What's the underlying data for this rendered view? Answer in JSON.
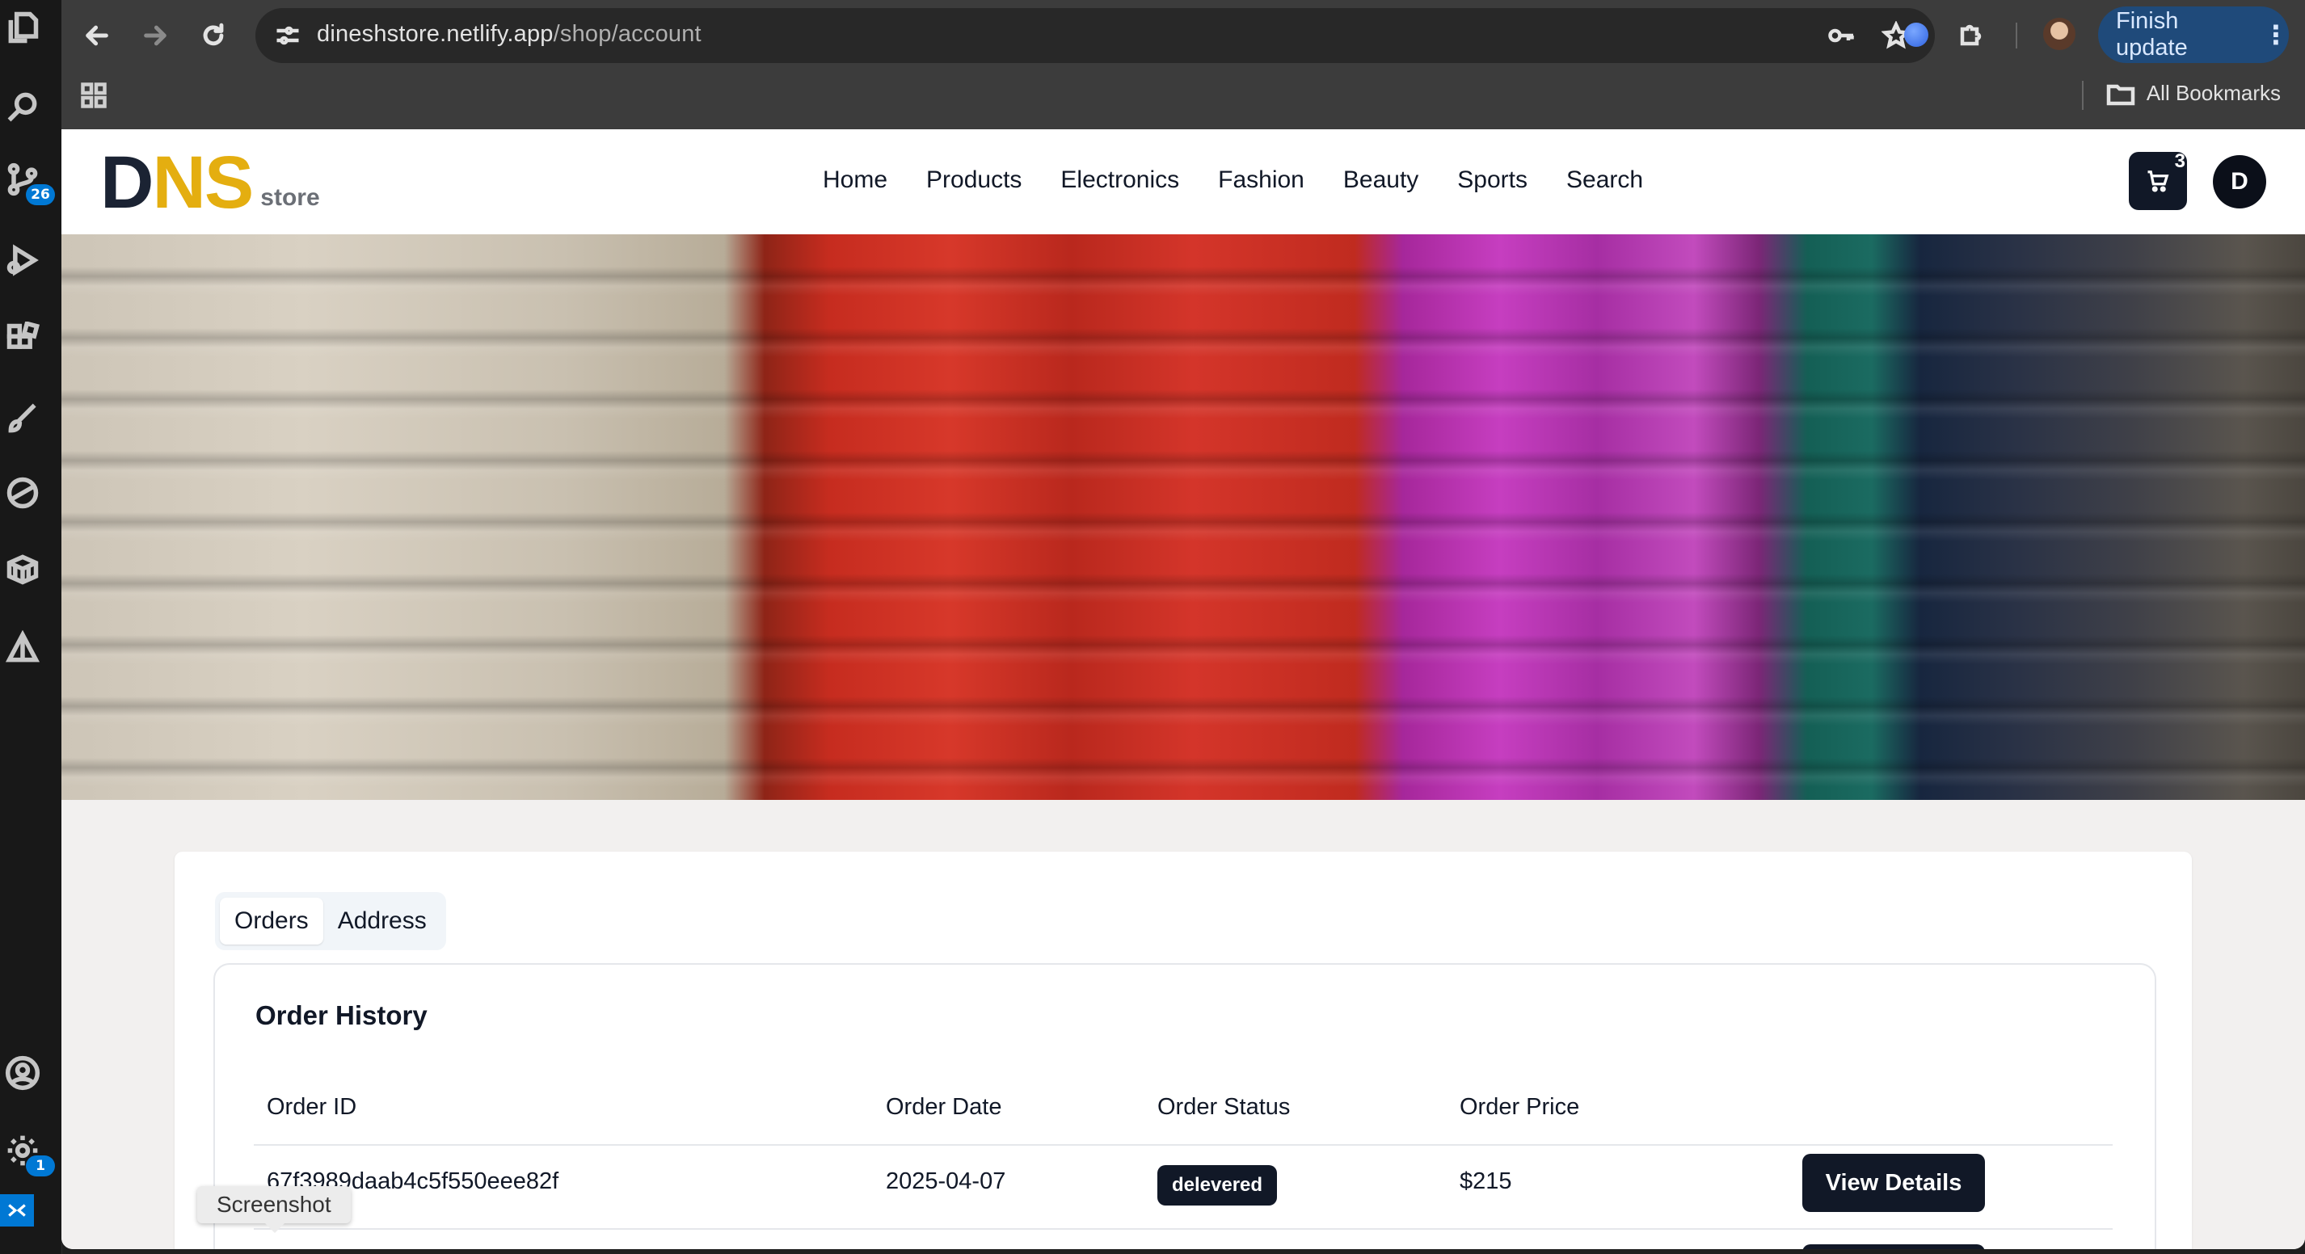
{
  "browser": {
    "url_host": "dineshstore.netlify.app",
    "url_path": "/shop/account",
    "finish_update_label": "Finish update",
    "bookmarks_label": "All Bookmarks"
  },
  "editor": {
    "source_control_badge": "26",
    "settings_badge": "1"
  },
  "site": {
    "logo_d": "D",
    "logo_ns": "NS",
    "logo_store": "store",
    "nav": [
      "Home",
      "Products",
      "Electronics",
      "Fashion",
      "Beauty",
      "Sports",
      "Search"
    ],
    "cart_count": "3",
    "user_initial": "D"
  },
  "account": {
    "tabs": [
      "Orders",
      "Address"
    ],
    "section_title": "Order History",
    "columns": [
      "Order ID",
      "Order Date",
      "Order Status",
      "Order Price"
    ],
    "orders": [
      {
        "id": "67f3989daab4c5f550eee82f",
        "date": "2025-04-07",
        "status": "delevered",
        "price": "$215",
        "action": "View Details"
      }
    ]
  },
  "tooltip": "Screenshot",
  "colors": {
    "logo_accent": "#e4ae10",
    "primary_dark": "#111827",
    "page_bg": "#f2f0ef",
    "finish_update_bg": "#1f4a7a"
  }
}
